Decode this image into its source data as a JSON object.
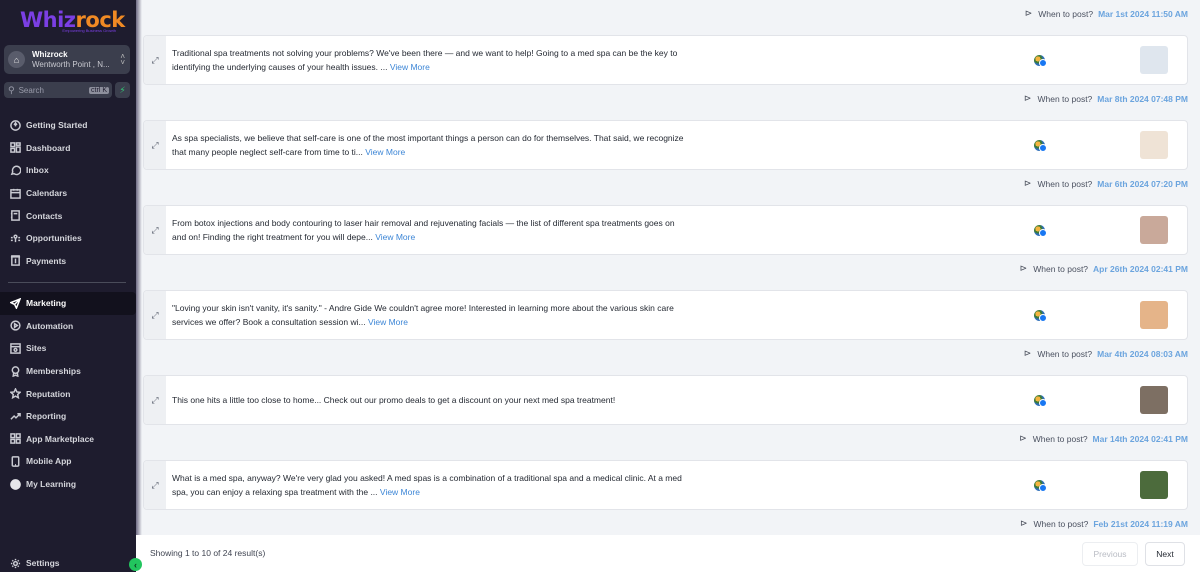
{
  "brand": {
    "logo_part1": "Whiz",
    "logo_part2": "rock",
    "tagline": "Empowering Business Growth"
  },
  "account": {
    "name": "Whizrock",
    "location": "Wentworth Point , N...",
    "switch_icon": "chevron-updown-icon"
  },
  "search": {
    "placeholder": "Search",
    "shortcut": "ctrl K"
  },
  "sidebar": {
    "items": [
      {
        "label": "Getting Started",
        "icon": "rocket-icon"
      },
      {
        "label": "Dashboard",
        "icon": "dashboard-icon"
      },
      {
        "label": "Inbox",
        "icon": "chat-icon"
      },
      {
        "label": "Calendars",
        "icon": "calendar-icon"
      },
      {
        "label": "Contacts",
        "icon": "contacts-icon"
      },
      {
        "label": "Opportunities",
        "icon": "opportunities-icon"
      },
      {
        "label": "Payments",
        "icon": "payments-icon"
      }
    ],
    "items2": [
      {
        "label": "Marketing",
        "icon": "send-icon",
        "active": true
      },
      {
        "label": "Automation",
        "icon": "automation-icon"
      },
      {
        "label": "Sites",
        "icon": "sites-icon"
      },
      {
        "label": "Memberships",
        "icon": "award-icon"
      },
      {
        "label": "Reputation",
        "icon": "star-icon"
      },
      {
        "label": "Reporting",
        "icon": "trend-icon"
      },
      {
        "label": "App Marketplace",
        "icon": "grid-icon"
      },
      {
        "label": "Mobile App",
        "icon": "phone-icon"
      },
      {
        "label": "My Learning",
        "icon": "circle-icon"
      }
    ],
    "settings": "Settings"
  },
  "when_label": "When to post?",
  "posts": [
    {
      "text": "Traditional spa treatments not solving your problems? We've been there — and we want to help! Going to a med spa can be the key to identifying the underlying causes of your health issues. ...",
      "view_more": "View More",
      "date": "Mar 8th 2024 07:48 PM",
      "thumb_color": "#dfe6ee"
    },
    {
      "text": "As spa specialists, we believe that self-care is one of the most important things a person can do for themselves. That said, we recognize that many people neglect self-care from time to ti...",
      "view_more": "View More",
      "date": "Mar 6th 2024 07:20 PM",
      "thumb_color": "#efe3d6"
    },
    {
      "text": "From botox injections and body contouring to laser hair removal and rejuvenating facials — the list of different spa treatments goes on and on! Finding the right treatment for you will depe...",
      "view_more": "View More",
      "date": "Apr 26th 2024 02:41 PM",
      "thumb_color": "#c9a99a"
    },
    {
      "text": "\"Loving your skin isn't vanity, it's sanity.\" - Andre Gide We couldn't agree more! Interested in learning more about the various skin care services we offer? Book a consultation session wi...",
      "view_more": "View More",
      "date": "Mar 4th 2024 08:03 AM",
      "thumb_color": "#e5b489"
    },
    {
      "text": "This one hits a little too close to home... Check out our promo deals to get a discount on your next med spa treatment!",
      "view_more": "",
      "date": "Mar 14th 2024 02:41 PM",
      "thumb_color": "#7d6f63"
    },
    {
      "text": "What is a med spa, anyway? We're very glad you asked! A med spas is a combination of a traditional spa and a medical clinic. At a med spa, you can enjoy a relaxing spa treatment with the ...",
      "view_more": "View More",
      "date": "Feb 21st 2024 11:19 AM",
      "thumb_color": "#4c6b3c"
    }
  ],
  "top_date": "Mar 1st 2024 11:50 AM",
  "footer": {
    "info": "Showing 1 to 10 of 24 result(s)",
    "prev": "Previous",
    "next": "Next"
  },
  "colors": {
    "accent": "#6ba4de",
    "sidebar_bg": "#1e1c2e",
    "active_green": "#22c55e"
  }
}
